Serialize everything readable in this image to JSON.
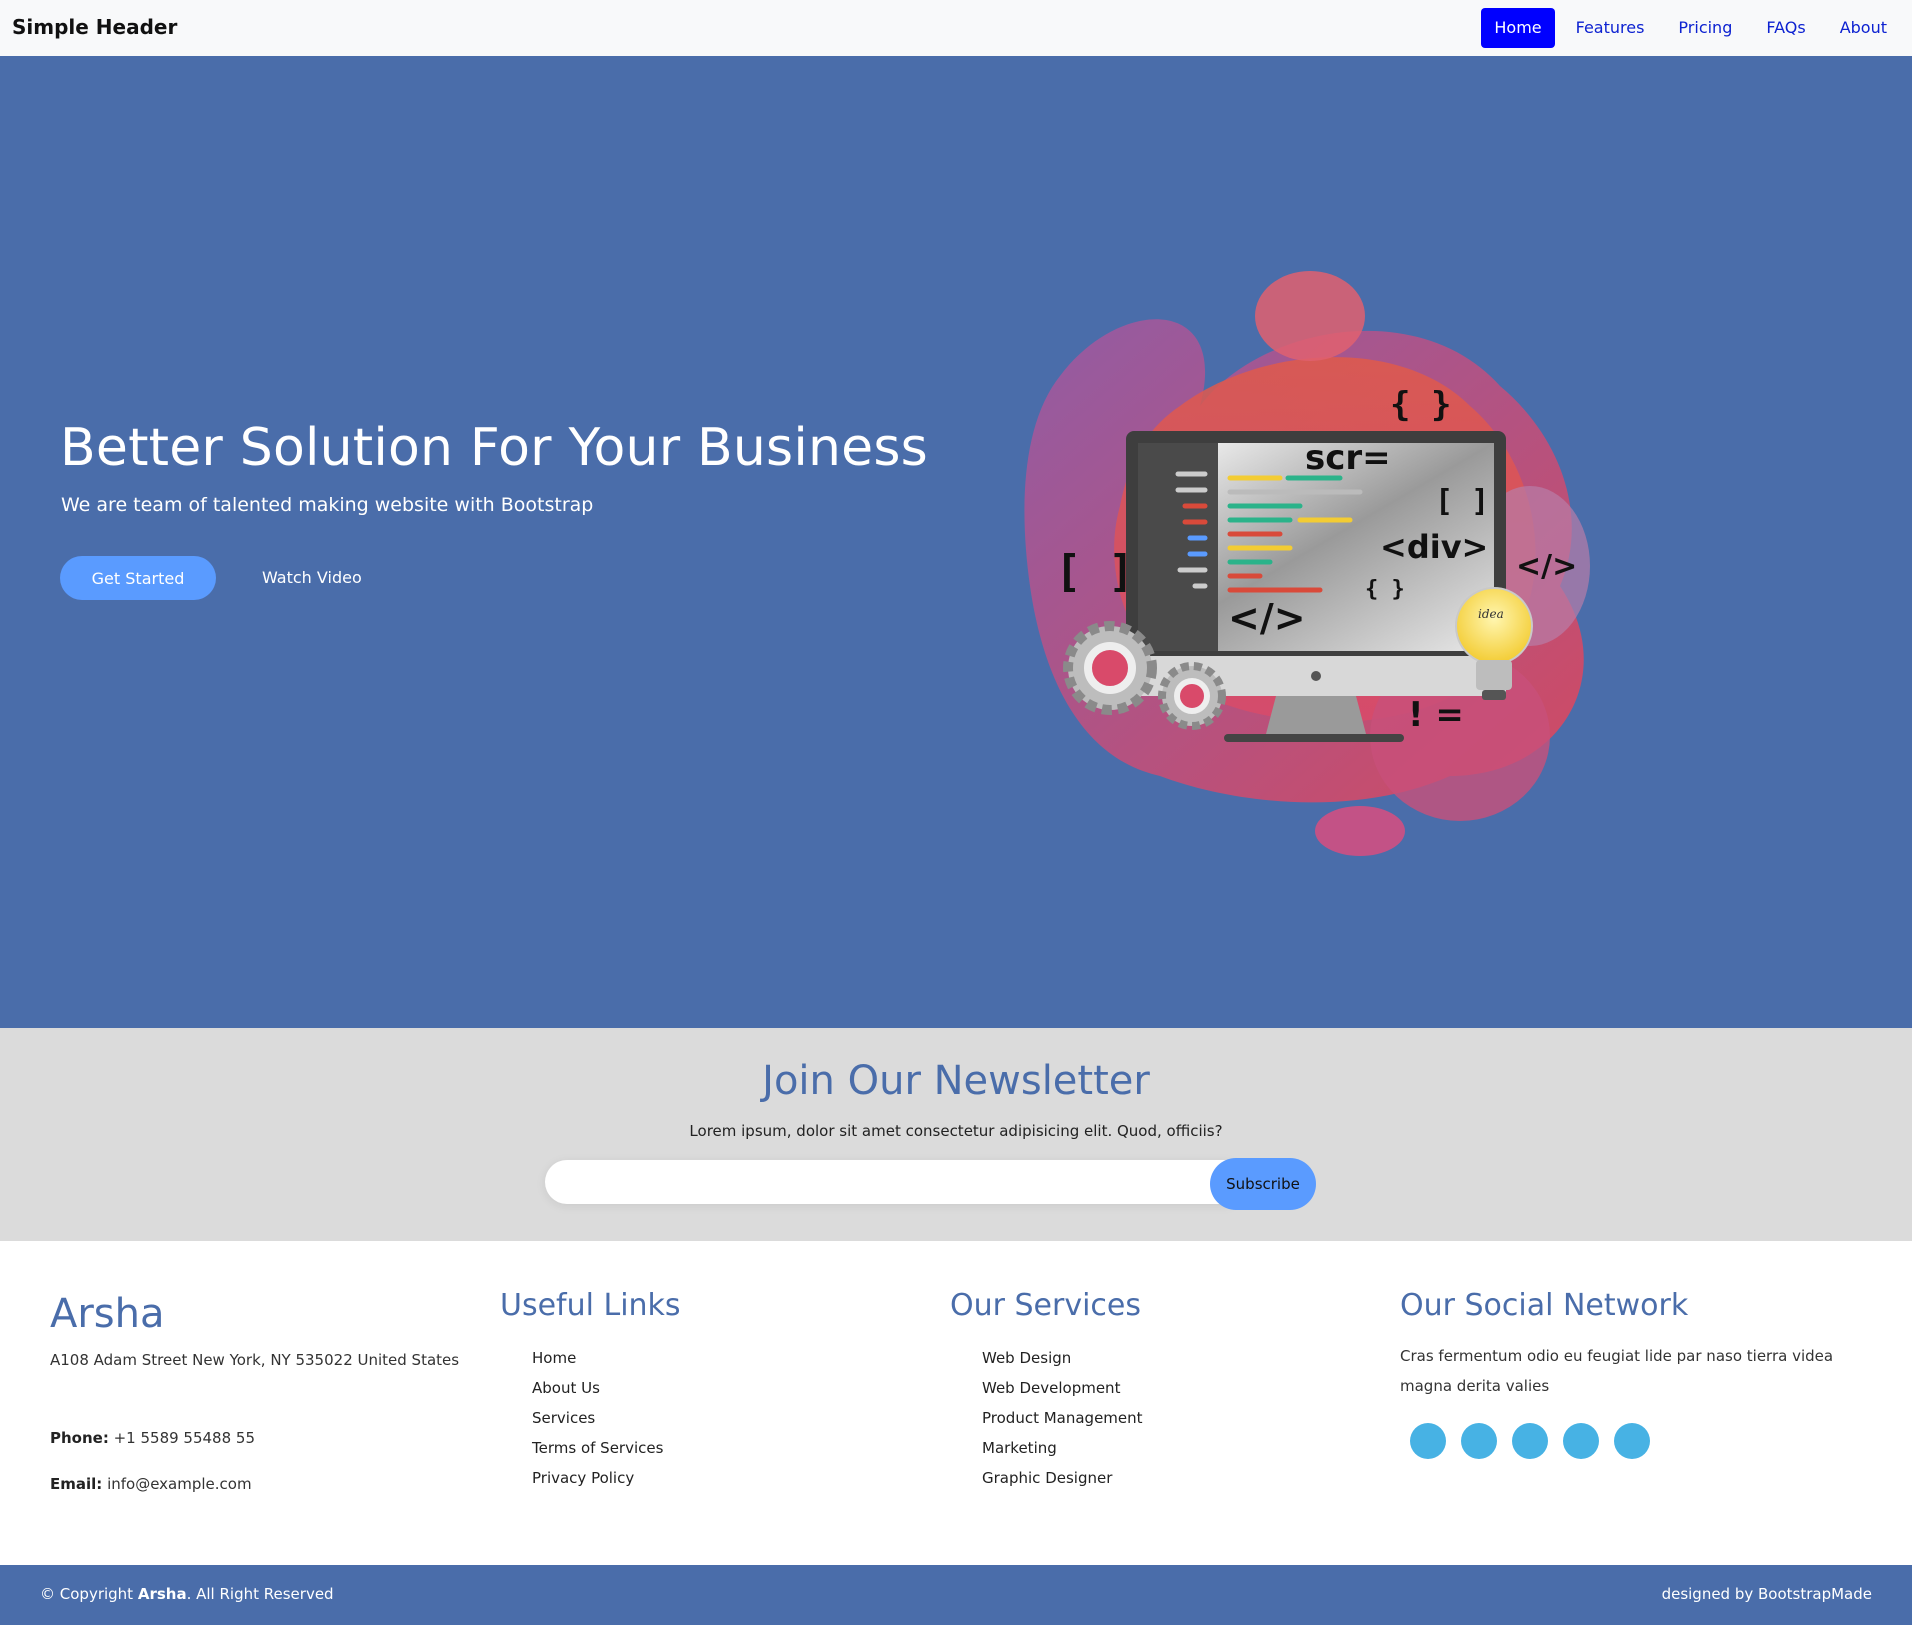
{
  "header": {
    "brand": "Simple Header",
    "nav": [
      "Home",
      "Features",
      "Pricing",
      "FAQs",
      "About"
    ],
    "active_index": 0
  },
  "hero": {
    "title": "Better Solution For Your Business",
    "subtitle": "We are team of talented making website with Bootstrap",
    "cta_primary": "Get Started",
    "cta_secondary": "Watch Video",
    "illustration": {
      "code_label": "scr=",
      "div_label": "<div>",
      "close_tag": "</>",
      "brackets": "[ ]",
      "braces": "{ }",
      "not_equal": "! =",
      "bulb_text": "idea"
    }
  },
  "newsletter": {
    "title": "Join Our Newsletter",
    "text": "Lorem ipsum, dolor sit amet consectetur adipisicing elit. Quod, officiis?",
    "input_value": "",
    "button": "Subscribe"
  },
  "footer": {
    "brand": "Arsha",
    "address": "A108 Adam Street New York, NY 535022 United States",
    "phone_label": "Phone:",
    "phone": "+1 5589 55488 55",
    "email_label": "Email:",
    "email": "info@example.com",
    "useful_links": {
      "title": "Useful Links",
      "items": [
        "Home",
        "About Us",
        "Services",
        "Terms of Services",
        "Privacy Policy"
      ]
    },
    "services": {
      "title": "Our Services",
      "items": [
        "Web Design",
        "Web Development",
        "Product Management",
        "Marketing",
        "Graphic Designer"
      ]
    },
    "social": {
      "title": "Our Social Network",
      "text": "Cras fermentum odio eu feugiat lide par naso tierra videa magna derita valies",
      "icons": [
        "twitter-icon",
        "facebook-icon",
        "instagram-icon",
        "skype-icon",
        "linkedin-icon"
      ],
      "color": "#47b2e4"
    }
  },
  "bottom": {
    "copyright_prefix": "© Copyright",
    "copyright_brand": "Arsha",
    "copyright_suffix": ". All Right Reserved",
    "designed": "designed by BootstrapMade"
  },
  "colors": {
    "primary": "#4a6daa",
    "accent": "#5a9bff",
    "nav_active": "#0000ff",
    "newsletter_bg": "#dbdbdb"
  }
}
